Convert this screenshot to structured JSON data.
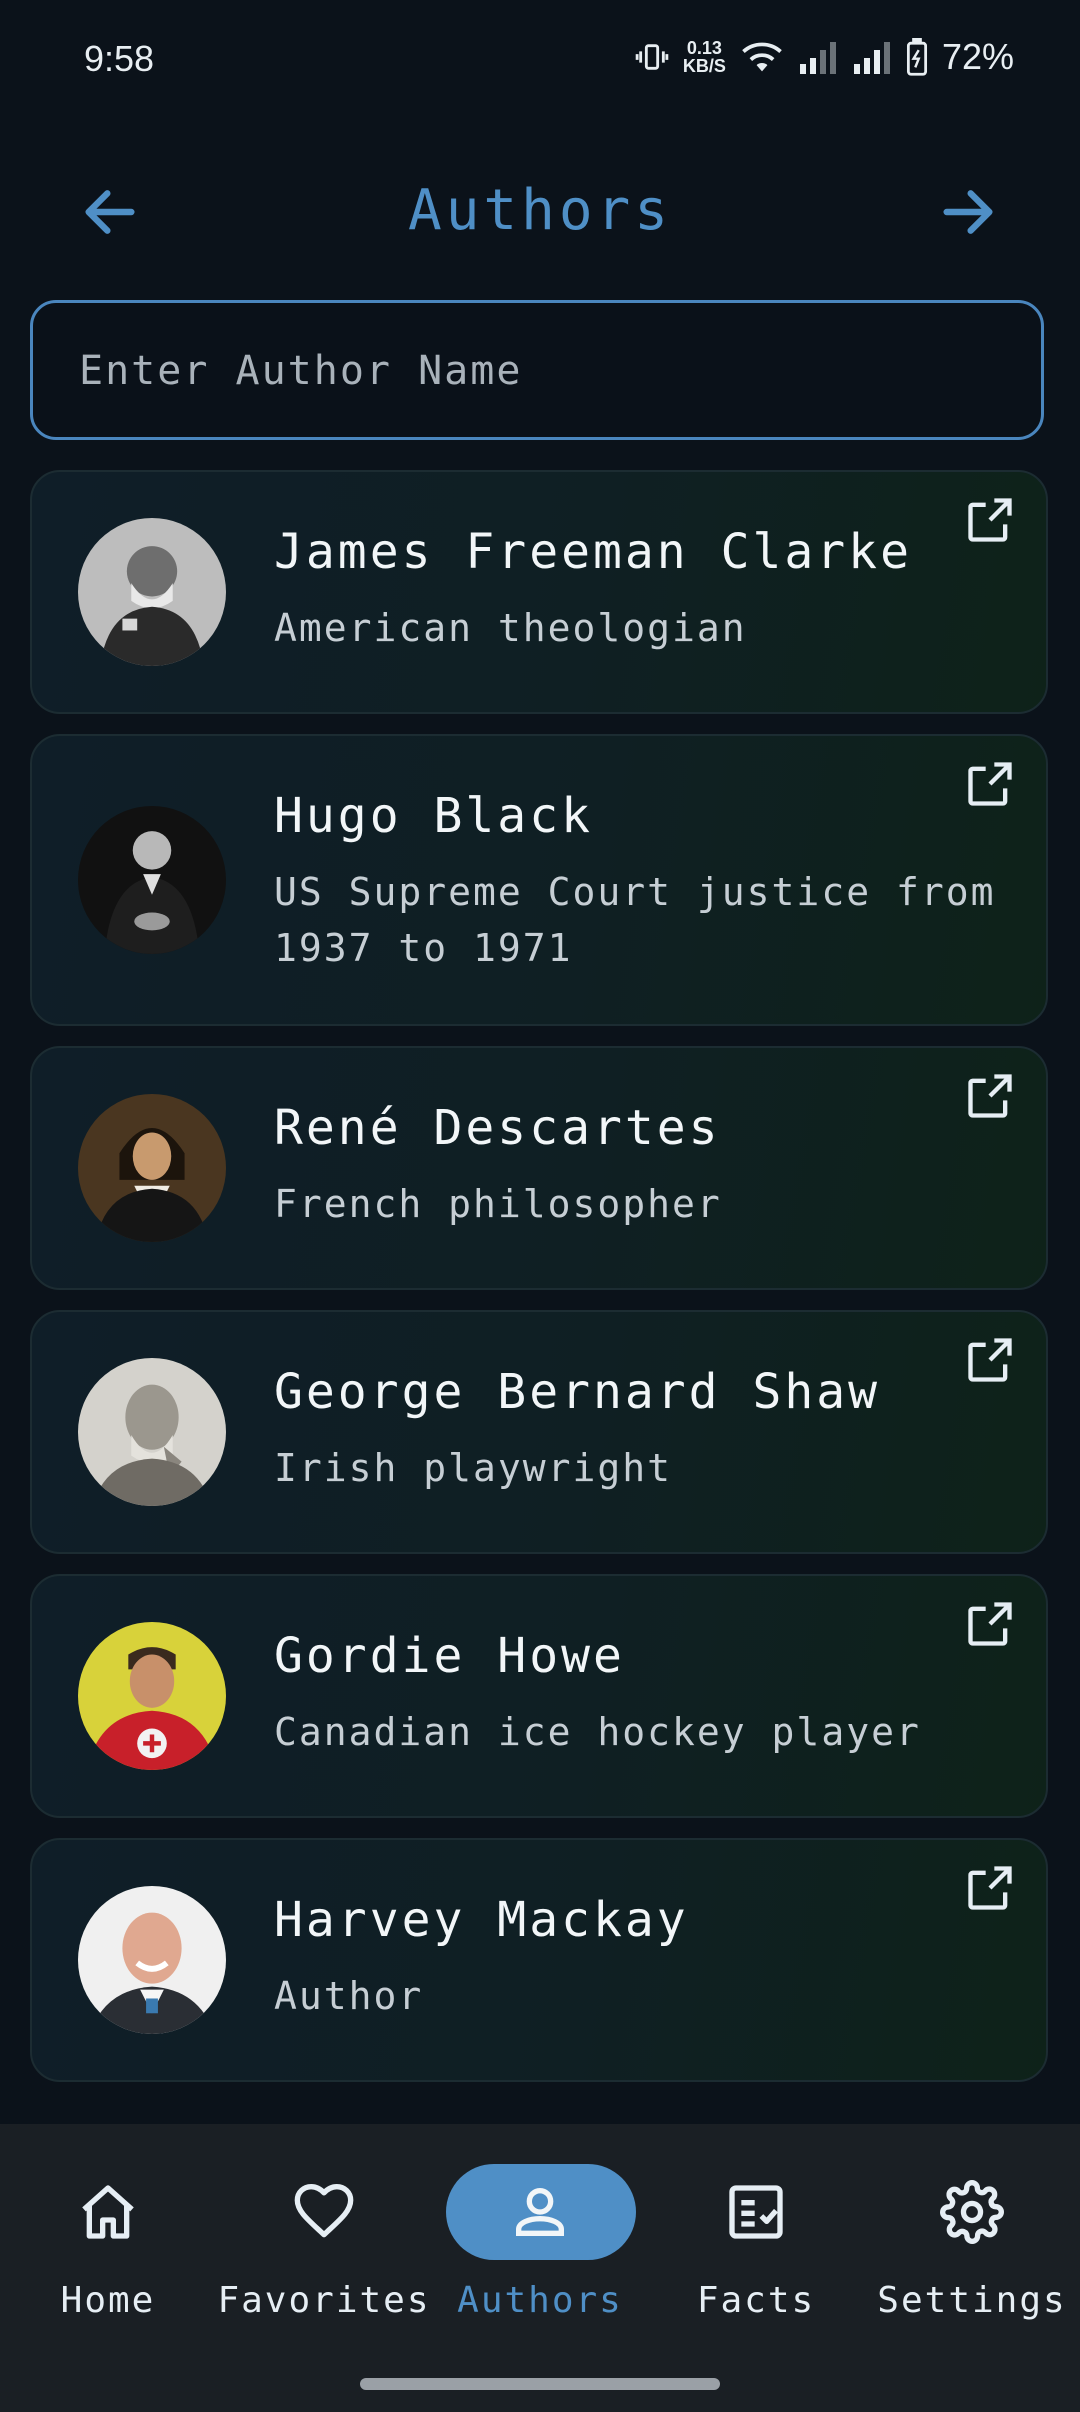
{
  "status": {
    "time": "9:58",
    "net_speed_value": "0.13",
    "net_speed_unit": "KB/S",
    "battery": "72%"
  },
  "header": {
    "title": "Authors"
  },
  "search": {
    "placeholder": "Enter Author Name",
    "value": ""
  },
  "authors": [
    {
      "name": "James Freeman Clarke",
      "description": "American theologian"
    },
    {
      "name": "Hugo Black",
      "description": "US Supreme Court justice from 1937 to 1971"
    },
    {
      "name": "René Descartes",
      "description": "French philosopher"
    },
    {
      "name": "George Bernard Shaw",
      "description": "Irish playwright"
    },
    {
      "name": "Gordie Howe",
      "description": "Canadian ice hockey player"
    },
    {
      "name": "Harvey Mackay",
      "description": "Author"
    }
  ],
  "bottom_nav": {
    "active": "Authors",
    "items": [
      {
        "label": "Home",
        "icon": "home-icon"
      },
      {
        "label": "Favorites",
        "icon": "heart-icon"
      },
      {
        "label": "Authors",
        "icon": "person-icon"
      },
      {
        "label": "Facts",
        "icon": "checklist-icon"
      },
      {
        "label": "Settings",
        "icon": "gear-icon"
      }
    ]
  },
  "colors": {
    "accent": "#4f8fc6",
    "background": "#0b121a",
    "nav_background": "#1a1f24"
  }
}
